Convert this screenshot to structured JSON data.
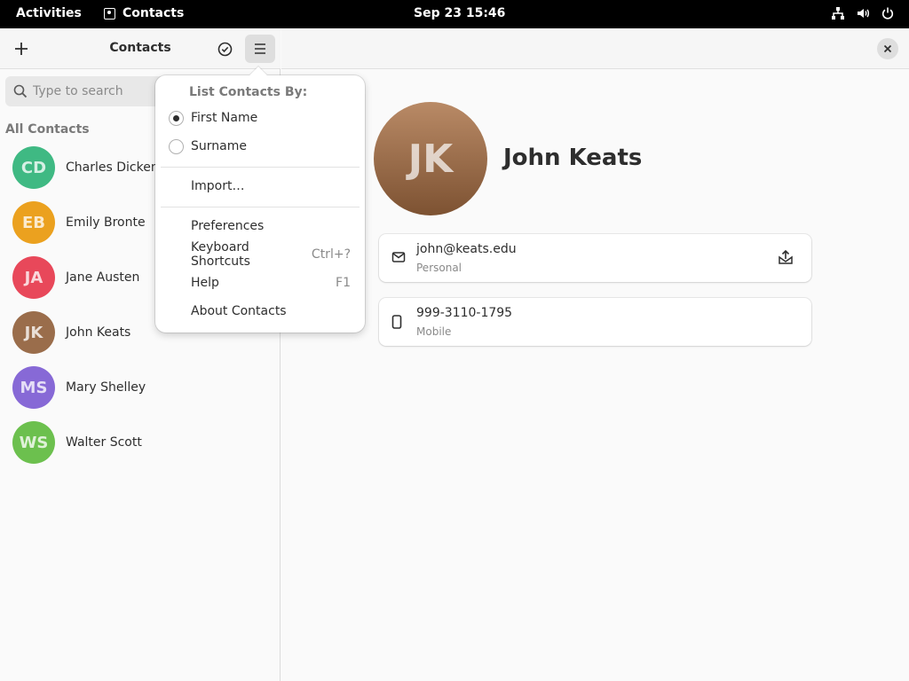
{
  "topbar": {
    "activities": "Activities",
    "app_name": "Contacts",
    "clock": "Sep 23  15:46"
  },
  "sidebar": {
    "title": "Contacts",
    "search_placeholder": "Type to search",
    "section_label": "All Contacts",
    "contacts": [
      {
        "initials": "CD",
        "name": "Charles Dickens",
        "color": "#3fb983"
      },
      {
        "initials": "EB",
        "name": "Emily Bronte",
        "color": "#eba11f"
      },
      {
        "initials": "JA",
        "name": "Jane Austen",
        "color": "#e8485a"
      },
      {
        "initials": "JK",
        "name": "John Keats",
        "color": "#9a6d4b"
      },
      {
        "initials": "MS",
        "name": "Mary Shelley",
        "color": "#8769d6"
      },
      {
        "initials": "WS",
        "name": "Walter Scott",
        "color": "#6cc04e"
      }
    ]
  },
  "menu": {
    "heading": "List Contacts By:",
    "sort_options": [
      {
        "label": "First Name",
        "checked": true
      },
      {
        "label": "Surname",
        "checked": false
      }
    ],
    "import": "Import…",
    "preferences": "Preferences",
    "shortcuts": "Keyboard Shortcuts",
    "shortcuts_accel": "Ctrl+?",
    "help": "Help",
    "help_accel": "F1",
    "about": "About Contacts"
  },
  "detail": {
    "initials": "JK",
    "name": "John Keats",
    "email": "john@keats.edu",
    "email_type": "Personal",
    "phone": "999-3110-1795",
    "phone_type": "Mobile"
  }
}
